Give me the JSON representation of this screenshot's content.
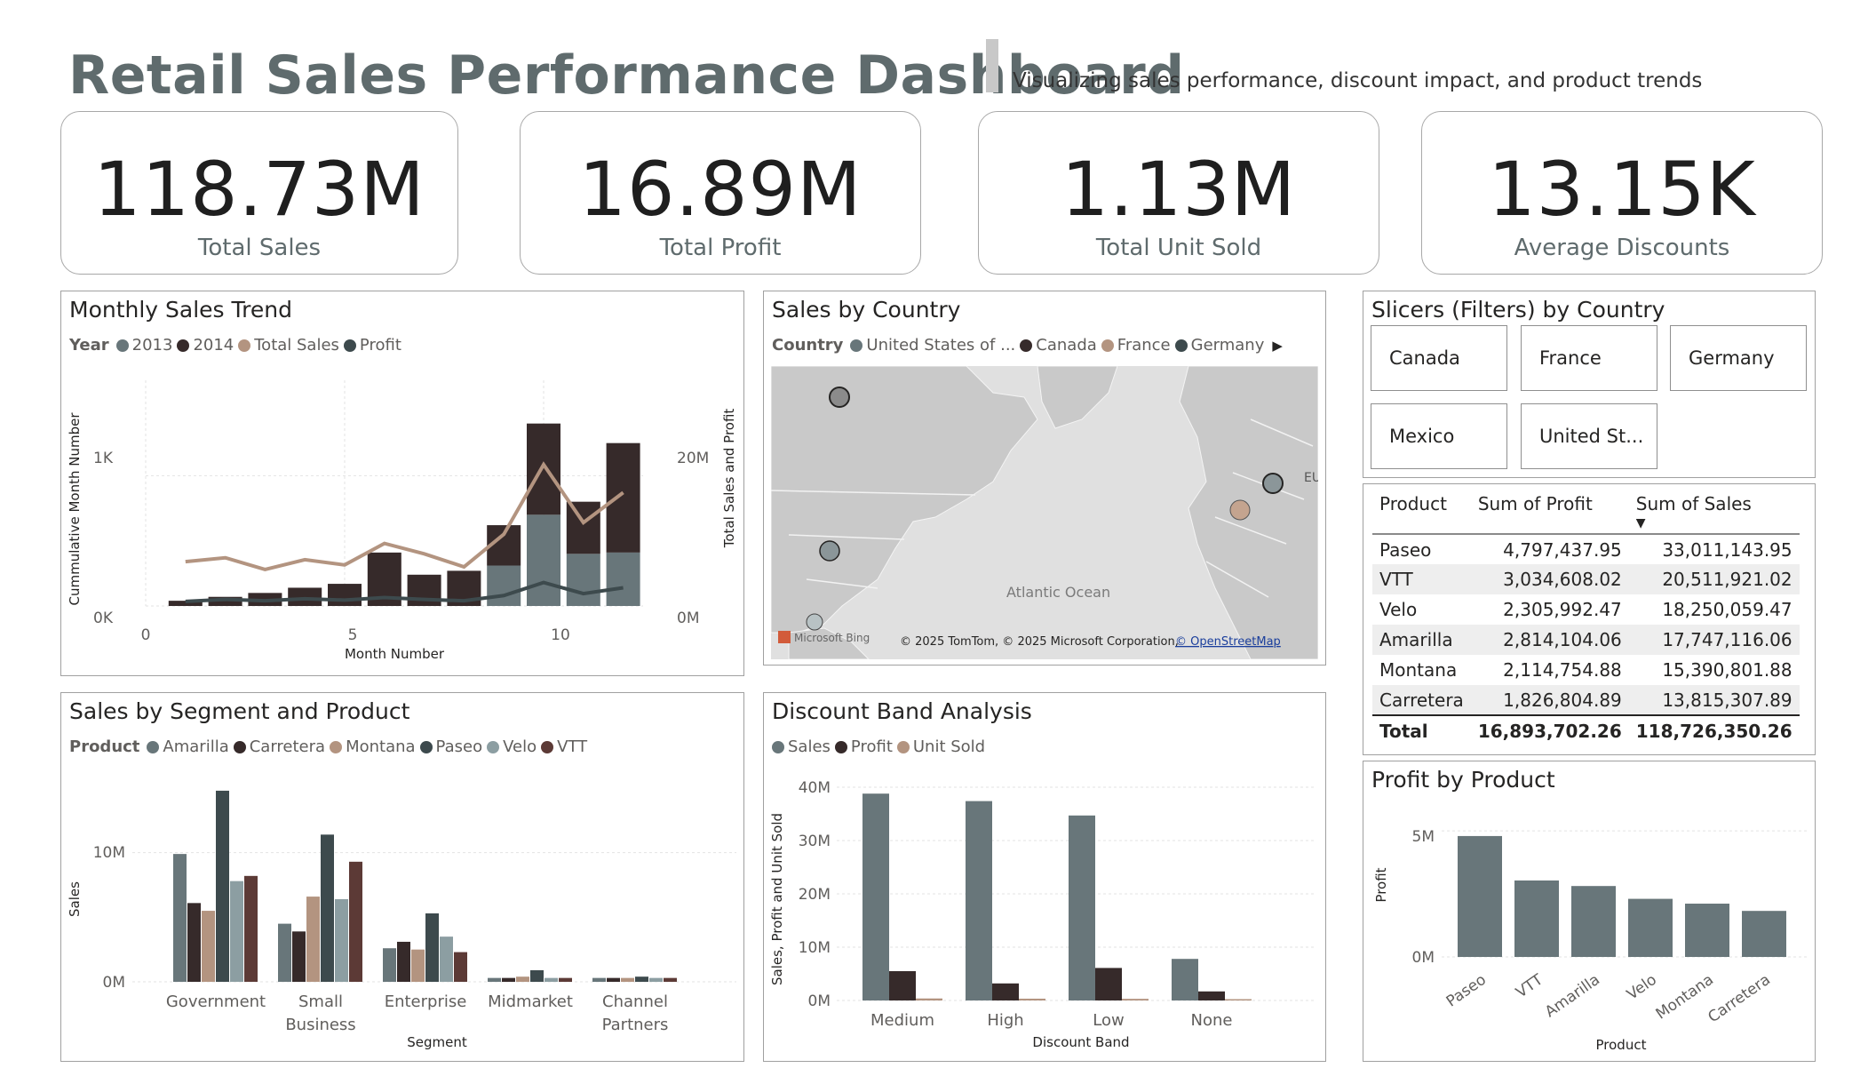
{
  "header": {
    "title": "Retail Sales Performance Dashboard",
    "subtitle": "Visualizing sales performance, discount impact, and product trends"
  },
  "kpis": [
    {
      "value": "118.73M",
      "label": "Total Sales"
    },
    {
      "value": "16.89M",
      "label": "Total Profit"
    },
    {
      "value": "1.13M",
      "label": "Total Unit Sold"
    },
    {
      "value": "13.15K",
      "label": "Average Discounts"
    }
  ],
  "colors": {
    "slate": "#68767a",
    "dark": "#362a2a",
    "tan": "#b39480",
    "charcoal": "#3d4a4d",
    "light_slate": "#8c9ea2",
    "brown": "#5c3a36",
    "map_land": "#c9c9c9",
    "map_water": "#e0e0e0"
  },
  "monthly": {
    "title": "Monthly Sales Trend",
    "legend_title": "Year",
    "legend": [
      {
        "label": "2013",
        "color": "#68767a"
      },
      {
        "label": "2014",
        "color": "#362a2a"
      },
      {
        "label": "Total Sales",
        "color": "#b39480"
      },
      {
        "label": "Profit",
        "color": "#3d4a4d"
      }
    ],
    "y_left_label": "Cummulative Month Number",
    "y_right_label": "Total Sales and Profit",
    "x_label": "Month Number",
    "y_left_ticks": [
      "0K",
      "1K"
    ],
    "y_right_ticks": [
      "0M",
      "20M"
    ],
    "x_ticks": [
      "0",
      "5",
      "10"
    ]
  },
  "country": {
    "title": "Sales by Country",
    "legend_title": "Country",
    "legend": [
      {
        "label": "United States of ...",
        "color": "#68767a"
      },
      {
        "label": "Canada",
        "color": "#362a2a"
      },
      {
        "label": "France",
        "color": "#b39480"
      },
      {
        "label": "Germany",
        "color": "#3d4a4d"
      }
    ],
    "legend_arrow": "▶",
    "ocean_label": "Atlantic Ocean",
    "eu_label": "EU",
    "attribution": "© 2025 TomTom, © 2025 Microsoft Corporation,",
    "osm_link": "© OpenStreetMap",
    "bing_logo": "Microsoft Bing"
  },
  "slicers": {
    "title": "Slicers (Filters) by Country",
    "items": [
      "Canada",
      "France",
      "Germany",
      "Mexico",
      "United St..."
    ]
  },
  "product_table": {
    "headers": [
      "Product",
      "Sum of Profit",
      "Sum of Sales"
    ],
    "sort_indicator": "▼",
    "rows": [
      [
        "Paseo",
        "4,797,437.95",
        "33,011,143.95"
      ],
      [
        "VTT",
        "3,034,608.02",
        "20,511,921.02"
      ],
      [
        "Velo",
        "2,305,992.47",
        "18,250,059.47"
      ],
      [
        "Amarilla",
        "2,814,104.06",
        "17,747,116.06"
      ],
      [
        "Montana",
        "2,114,754.88",
        "15,390,801.88"
      ],
      [
        "Carretera",
        "1,826,804.89",
        "13,815,307.89"
      ]
    ],
    "total": [
      "Total",
      "16,893,702.26",
      "118,726,350.26"
    ]
  },
  "segment": {
    "title": "Sales by Segment and Product",
    "legend_title": "Product",
    "legend": [
      {
        "label": "Amarilla",
        "color": "#68767a"
      },
      {
        "label": "Carretera",
        "color": "#362a2a"
      },
      {
        "label": "Montana",
        "color": "#b39480"
      },
      {
        "label": "Paseo",
        "color": "#3d4a4d"
      },
      {
        "label": "Velo",
        "color": "#8c9ea2"
      },
      {
        "label": "VTT",
        "color": "#5c3a36"
      }
    ],
    "y_label": "Sales",
    "x_label": "Segment",
    "y_ticks": [
      "0M",
      "10M"
    ]
  },
  "discount": {
    "title": "Discount Band Analysis",
    "legend": [
      {
        "label": "Sales",
        "color": "#68767a"
      },
      {
        "label": "Profit",
        "color": "#362a2a"
      },
      {
        "label": "Unit Sold",
        "color": "#b39480"
      }
    ],
    "y_label": "Sales, Profit and Unit Sold",
    "x_label": "Discount Band",
    "y_ticks": [
      "0M",
      "10M",
      "20M",
      "30M",
      "40M"
    ]
  },
  "profit_product": {
    "title": "Profit by Product",
    "y_label": "Profit",
    "x_label": "Product",
    "y_ticks": [
      "0M",
      "5M"
    ]
  },
  "chart_data": [
    {
      "type": "bar",
      "title": "Monthly Sales Trend",
      "xlabel": "Month Number",
      "ylabel": "Cummulative Month Number",
      "y2label": "Total Sales and Profit",
      "x": [
        1,
        2,
        3,
        4,
        5,
        6,
        7,
        8,
        9,
        10,
        11,
        12
      ],
      "xlim": [
        0,
        12.5
      ],
      "ylim": [
        0,
        1500
      ],
      "y2lim": [
        0,
        30000000
      ],
      "series": [
        {
          "name": "2013",
          "kind": "stacked-bar",
          "values": [
            0,
            0,
            0,
            0,
            0,
            0,
            0,
            0,
            310,
            700,
            400,
            410
          ]
        },
        {
          "name": "2014",
          "kind": "stacked-bar",
          "values": [
            40,
            70,
            100,
            140,
            170,
            410,
            240,
            270,
            310,
            700,
            400,
            840
          ]
        },
        {
          "name": "Total Sales",
          "kind": "line",
          "axis": "right",
          "values": [
            6800000,
            7400000,
            5600000,
            7100000,
            6300000,
            9600000,
            8000000,
            6000000,
            11000000,
            21700000,
            12800000,
            17400000
          ]
        },
        {
          "name": "Profit",
          "kind": "line",
          "axis": "right",
          "values": [
            700000,
            1000000,
            800000,
            1100000,
            900000,
            1300000,
            1000000,
            800000,
            1600000,
            3600000,
            1900000,
            2800000
          ]
        }
      ]
    },
    {
      "type": "bar",
      "title": "Sales by Segment and Product",
      "xlabel": "Segment",
      "ylabel": "Sales",
      "categories": [
        "Government",
        "Small Business",
        "Enterprise",
        "Midmarket",
        "Channel Partners"
      ],
      "ylim": [
        0,
        15000000
      ],
      "series": [
        {
          "name": "Amarilla",
          "values": [
            9900000,
            4500000,
            2600000,
            300000,
            300000
          ]
        },
        {
          "name": "Carretera",
          "values": [
            6100000,
            3900000,
            3100000,
            300000,
            300000
          ]
        },
        {
          "name": "Montana",
          "values": [
            5500000,
            6600000,
            2500000,
            400000,
            300000
          ]
        },
        {
          "name": "Paseo",
          "values": [
            14800000,
            11400000,
            5300000,
            900000,
            400000
          ]
        },
        {
          "name": "Velo",
          "values": [
            7800000,
            6400000,
            3500000,
            300000,
            300000
          ]
        },
        {
          "name": "VTT",
          "values": [
            8200000,
            9300000,
            2300000,
            300000,
            300000
          ]
        }
      ]
    },
    {
      "type": "bar",
      "title": "Discount Band Analysis",
      "xlabel": "Discount Band",
      "ylabel": "Sales, Profit and Unit Sold",
      "categories": [
        "Medium",
        "High",
        "Low",
        "None"
      ],
      "ylim": [
        0,
        40000000
      ],
      "series": [
        {
          "name": "Sales",
          "values": [
            38800000,
            37400000,
            34700000,
            7800000
          ]
        },
        {
          "name": "Profit",
          "values": [
            5500000,
            3200000,
            6100000,
            1700000
          ]
        },
        {
          "name": "Unit Sold",
          "values": [
            380000,
            340000,
            310000,
            100000
          ]
        }
      ]
    },
    {
      "type": "bar",
      "title": "Profit by Product",
      "xlabel": "Product",
      "ylabel": "Profit",
      "categories": [
        "Paseo",
        "VTT",
        "Amarilla",
        "Velo",
        "Montana",
        "Carretera"
      ],
      "values": [
        4797437.95,
        3034608.02,
        2814104.06,
        2305992.47,
        2114754.88,
        1826804.89
      ],
      "ylim": [
        0,
        5500000
      ]
    }
  ]
}
